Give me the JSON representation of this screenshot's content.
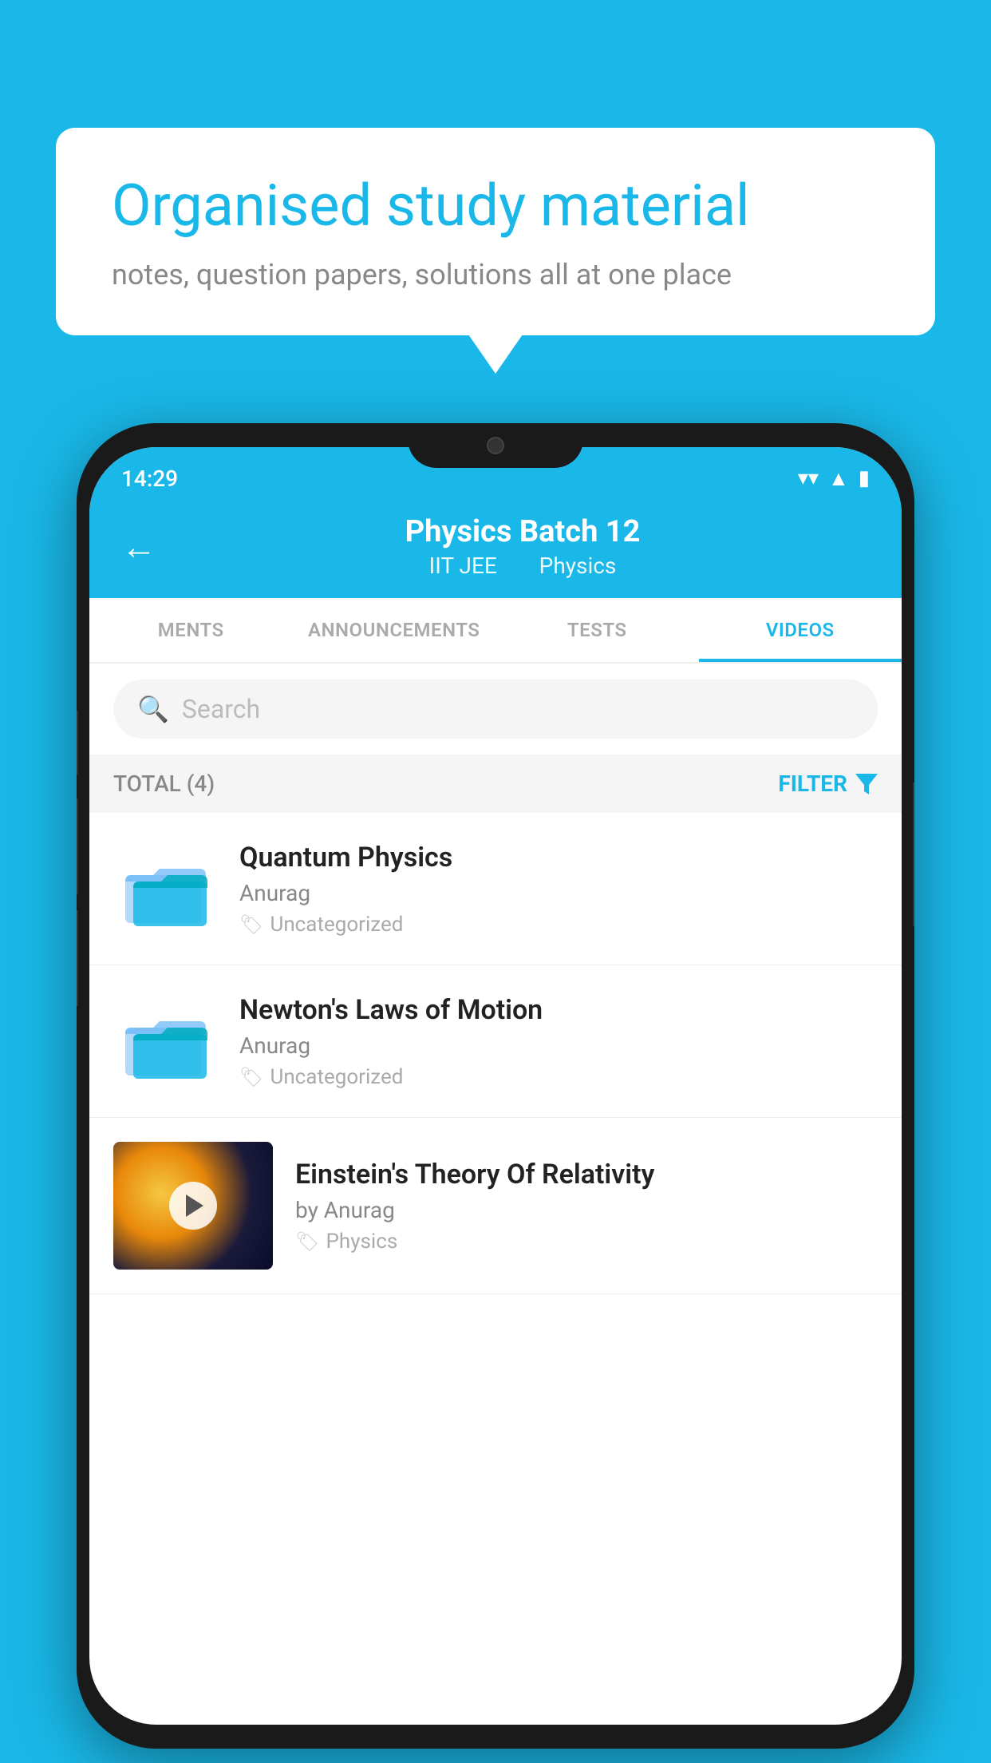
{
  "background": {
    "color": "#1ab8e8"
  },
  "speech_bubble": {
    "title": "Organised study material",
    "subtitle": "notes, question papers, solutions all at one place"
  },
  "phone": {
    "status_bar": {
      "time": "14:29"
    },
    "header": {
      "title": "Physics Batch 12",
      "subtitle_part1": "IIT JEE",
      "subtitle_part2": "Physics",
      "back_label": "←"
    },
    "tabs": [
      {
        "label": "MENTS",
        "active": false
      },
      {
        "label": "ANNOUNCEMENTS",
        "active": false
      },
      {
        "label": "TESTS",
        "active": false
      },
      {
        "label": "VIDEOS",
        "active": true
      }
    ],
    "search": {
      "placeholder": "Search"
    },
    "filter": {
      "total_label": "TOTAL (4)",
      "filter_label": "FILTER"
    },
    "videos": [
      {
        "title": "Quantum Physics",
        "author": "Anurag",
        "tag": "Uncategorized",
        "type": "folder"
      },
      {
        "title": "Newton's Laws of Motion",
        "author": "Anurag",
        "tag": "Uncategorized",
        "type": "folder"
      },
      {
        "title": "Einstein's Theory Of Relativity",
        "author": "by Anurag",
        "tag": "Physics",
        "type": "video"
      }
    ]
  }
}
